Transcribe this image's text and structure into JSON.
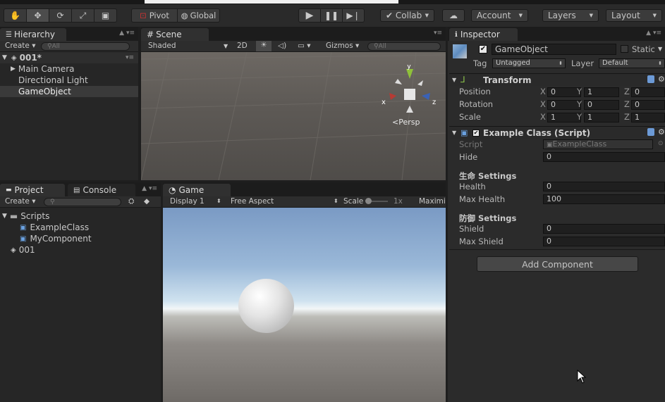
{
  "toolbar": {
    "pivot": "Pivot",
    "global": "Global",
    "collab": "Collab",
    "account": "Account",
    "layers": "Layers",
    "layout": "Layout"
  },
  "hierarchy": {
    "tab": "Hierarchy",
    "create": "Create",
    "search_placeholder": "All",
    "scene": "001*",
    "items": [
      "Main Camera",
      "Directional Light",
      "GameObject"
    ]
  },
  "scene_view": {
    "tab": "Scene",
    "shading": "Shaded",
    "mode_2d": "2D",
    "gizmos": "Gizmos",
    "search_placeholder": "All",
    "persp": "Persp",
    "axis_x": "x",
    "axis_y": "y",
    "axis_z": "z"
  },
  "project": {
    "tab": "Project",
    "console_tab": "Console",
    "create": "Create",
    "folder": "Scripts",
    "files": [
      "ExampleClass",
      "MyComponent"
    ],
    "scene_asset": "001"
  },
  "game_view": {
    "tab": "Game",
    "display": "Display 1",
    "aspect": "Free Aspect",
    "scale_label": "Scale",
    "scale_value": "1x",
    "maximize": "Maximi"
  },
  "inspector": {
    "tab": "Inspector",
    "object_name": "GameObject",
    "static_label": "Static",
    "tag_label": "Tag",
    "tag_value": "Untagged",
    "layer_label": "Layer",
    "layer_value": "Default",
    "transform": {
      "title": "Transform",
      "rows": [
        {
          "label": "Position",
          "x": "0",
          "y": "1",
          "z": "0"
        },
        {
          "label": "Rotation",
          "x": "0",
          "y": "0",
          "z": "0"
        },
        {
          "label": "Scale",
          "x": "1",
          "y": "1",
          "z": "1"
        }
      ],
      "axis_x": "X",
      "axis_y": "Y",
      "axis_z": "Z"
    },
    "script_component": {
      "title": "Example Class (Script)",
      "script_label": "Script",
      "script_value": "ExampleClass",
      "hide_label": "Hide",
      "hide_value": "0",
      "section1": "生命 Settings",
      "health_label": "Health",
      "health_value": "0",
      "max_health_label": "Max Health",
      "max_health_value": "100",
      "section2": "防御 Settings",
      "shield_label": "Shield",
      "shield_value": "0",
      "max_shield_label": "Max Shield",
      "max_shield_value": "0"
    },
    "add_component": "Add Component"
  }
}
